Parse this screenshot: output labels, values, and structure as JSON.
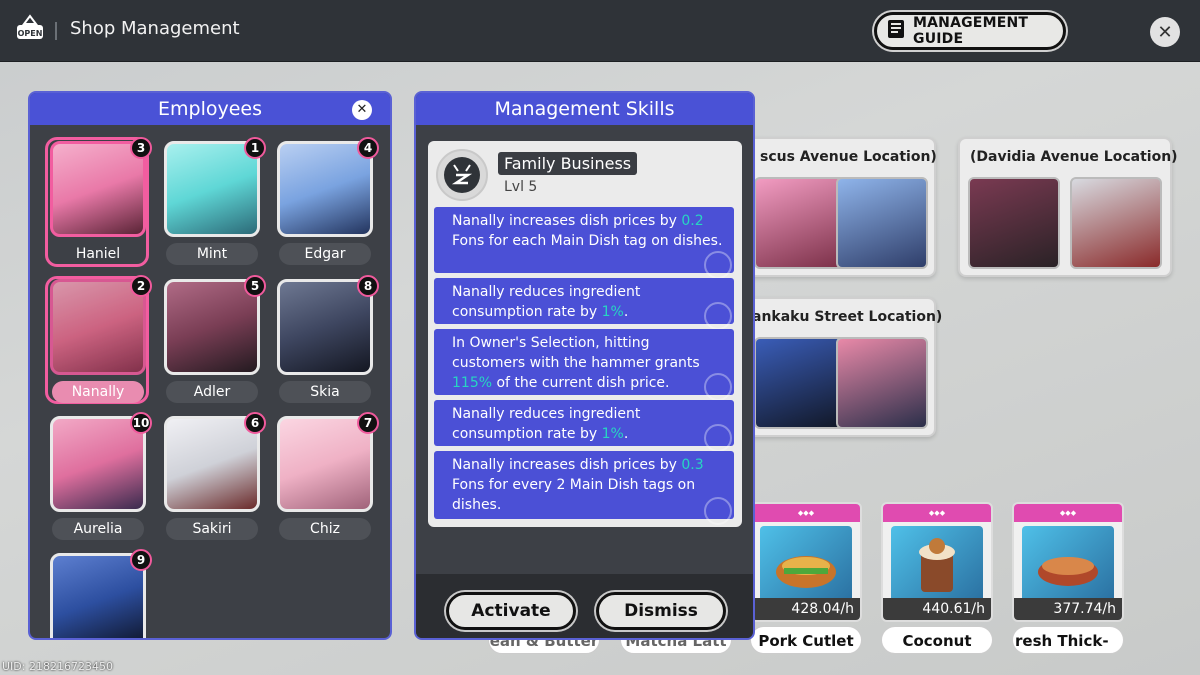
{
  "topbar": {
    "open_label": "OPEN",
    "title": "Shop Management",
    "guide_label": "MANAGEMENT GUIDE",
    "close": "✕"
  },
  "uid": "UID: 218216723450",
  "locations": [
    {
      "title": "scus Avenue Location)"
    },
    {
      "title": "(Davidia Avenue Location)"
    },
    {
      "title": "ankaku Street Location)"
    }
  ],
  "products": [
    {
      "price": "428.04/h",
      "name": "Pork Cutlet"
    },
    {
      "price": "440.61/h",
      "name": "Coconut"
    },
    {
      "price": "377.74/h",
      "name": "resh    Thick-"
    }
  ],
  "hidden_products": [
    "ean & Butter",
    "Matcha Latt"
  ],
  "employees": {
    "title": "Employees",
    "close": "✕",
    "list": [
      {
        "name": "Haniel",
        "badge": "3",
        "color": "#e979a8"
      },
      {
        "name": "Mint",
        "badge": "1",
        "color": "#5fd7d6"
      },
      {
        "name": "Edgar",
        "badge": "4",
        "color": "#7aa3e0"
      },
      {
        "name": "Nanally",
        "badge": "2",
        "color": "#e66a8c"
      },
      {
        "name": "Adler",
        "badge": "5",
        "color": "#7a3e55"
      },
      {
        "name": "Skia",
        "badge": "8",
        "color": "#3e4660"
      },
      {
        "name": "Aurelia",
        "badge": "10",
        "color": "#df6f9e"
      },
      {
        "name": "Sakiri",
        "badge": "6",
        "color": "#cfd1d8"
      },
      {
        "name": "Chiz",
        "badge": "7",
        "color": "#efb1c5"
      },
      {
        "name": "",
        "badge": "9",
        "color": "#2d4fa0"
      }
    ]
  },
  "skills": {
    "title": "Management Skills",
    "skill_name": "Family Business",
    "level": "Lvl 5",
    "effects": [
      {
        "pre": "Nanally increases dish prices by ",
        "hl": "0.2",
        "post": " Fons for each Main Dish tag on dishes."
      },
      {
        "pre": "Nanally reduces ingredient consumption rate by ",
        "hl": "1%",
        "post": "."
      },
      {
        "pre": "In Owner's Selection, hitting customers with the hammer grants ",
        "hl": "115%",
        "post": " of the current dish price."
      },
      {
        "pre": "Nanally reduces ingredient consumption rate by ",
        "hl": "1%",
        "post": "."
      },
      {
        "pre": "Nanally increases dish prices by ",
        "hl": "0.3",
        "post": " Fons for every 2 Main Dish tags on dishes."
      }
    ],
    "activate_label": "Activate",
    "dismiss_label": "Dismiss"
  }
}
